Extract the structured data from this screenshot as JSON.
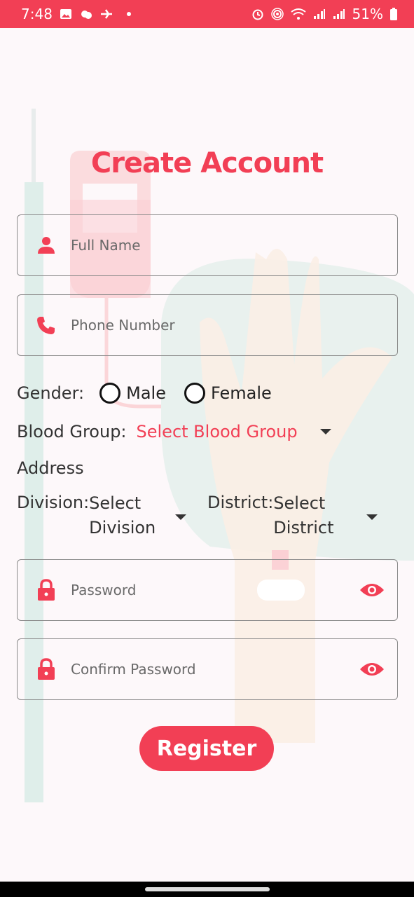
{
  "status_bar": {
    "time": "7:48",
    "battery": "51%"
  },
  "title": "Create Account",
  "fields": {
    "full_name": {
      "placeholder": "Full Name",
      "icon": "person-icon"
    },
    "phone": {
      "placeholder": "Phone Number",
      "icon": "phone-icon"
    },
    "password": {
      "placeholder": "Password",
      "icon": "lock-icon"
    },
    "confirm_password": {
      "placeholder": "Confirm Password",
      "icon": "lock-icon"
    }
  },
  "gender": {
    "label": "Gender:",
    "options": [
      "Male",
      "Female"
    ]
  },
  "blood_group": {
    "label": "Blood Group:",
    "selected": "Select Blood Group"
  },
  "address": {
    "label": "Address"
  },
  "division": {
    "label": "Division:",
    "value_line1": "Select",
    "value_line2": "Division"
  },
  "district": {
    "label": "District:",
    "value_line1": "Select",
    "value_line2": "District"
  },
  "register": {
    "label": "Register"
  },
  "colors": {
    "accent": "#f23f55",
    "status_bar": "#f23f55",
    "background": "#fdf8fa"
  }
}
